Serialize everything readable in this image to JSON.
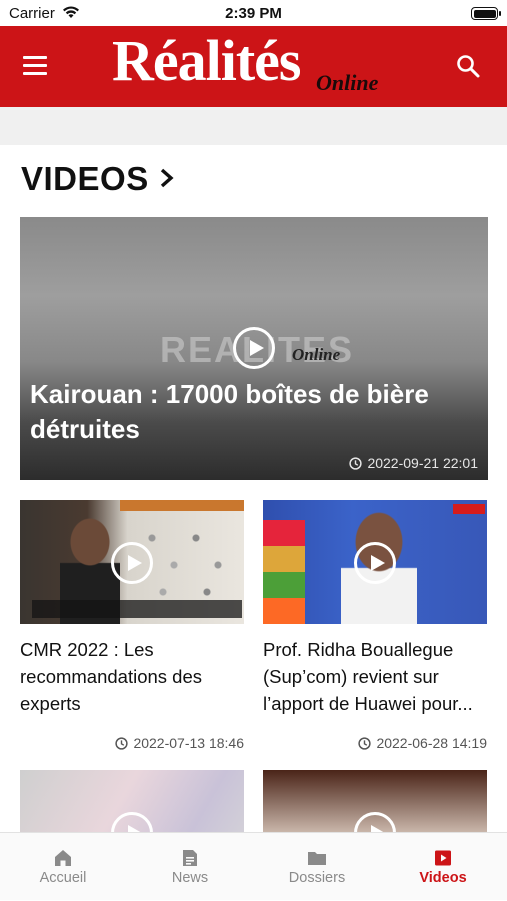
{
  "status_bar": {
    "carrier": "Carrier",
    "time": "2:39 PM"
  },
  "header": {
    "logo_main": "Réalités",
    "logo_sub": "Online"
  },
  "section": {
    "title": "VIDEOS"
  },
  "featured": {
    "watermark": "REALITES",
    "watermark_sub": "Online",
    "title": "Kairouan : 17000 boîtes de bière détruites",
    "date": "2022-09-21 22:01"
  },
  "cards": [
    {
      "title": "CMR 2022 : Les recommandations des experts",
      "date": "2022-07-13 18:46"
    },
    {
      "title": "Prof. Ridha Bouallegue (Sup’com) revient sur l’apport de Huawei pour...",
      "date": "2022-06-28 14:19"
    }
  ],
  "tabs": [
    {
      "label": "Accueil",
      "icon": "home-icon"
    },
    {
      "label": "News",
      "icon": "news-icon"
    },
    {
      "label": "Dossiers",
      "icon": "folder-icon"
    },
    {
      "label": "Videos",
      "icon": "video-icon",
      "active": true
    }
  ],
  "colors": {
    "brand": "#cc1417",
    "tab_inactive": "#8a8a8a"
  }
}
